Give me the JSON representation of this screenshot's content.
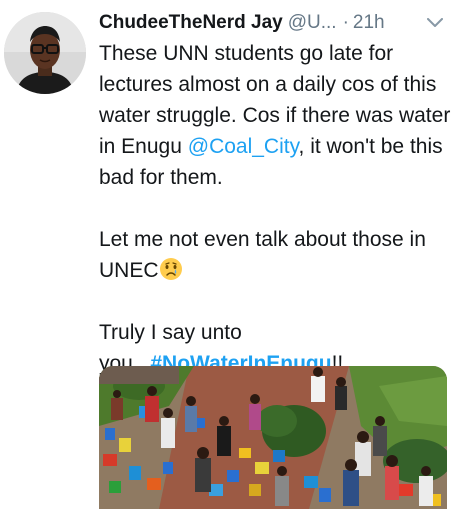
{
  "tweet": {
    "display_name": "ChudeeTheNerd Jay",
    "handle": "@U...",
    "separator": "·",
    "time": "21h",
    "avatar_icon": "user-avatar-photo",
    "menu_icon": "chevron-down-icon",
    "text": {
      "p1_part1": "These UNN students go late for lectures almost on a daily cos of this water struggle. Cos if there was water in Enugu ",
      "p1_mention": "@Coal_City",
      "p1_part2": ", it won't be this bad for them.",
      "p2_text": "Let me not even talk about those in UNEC",
      "p2_emoji": "crying-face-emoji",
      "p3_part1": "Truly I say unto you...",
      "p3_hashtag": "#NoWaterInEnugu",
      "p3_part2": "!!"
    },
    "media": {
      "description_icon": "crowd-with-water-containers-photo"
    },
    "colors": {
      "link": "#1da1f2",
      "secondary_text": "#657786",
      "primary_text": "#14171a"
    }
  }
}
